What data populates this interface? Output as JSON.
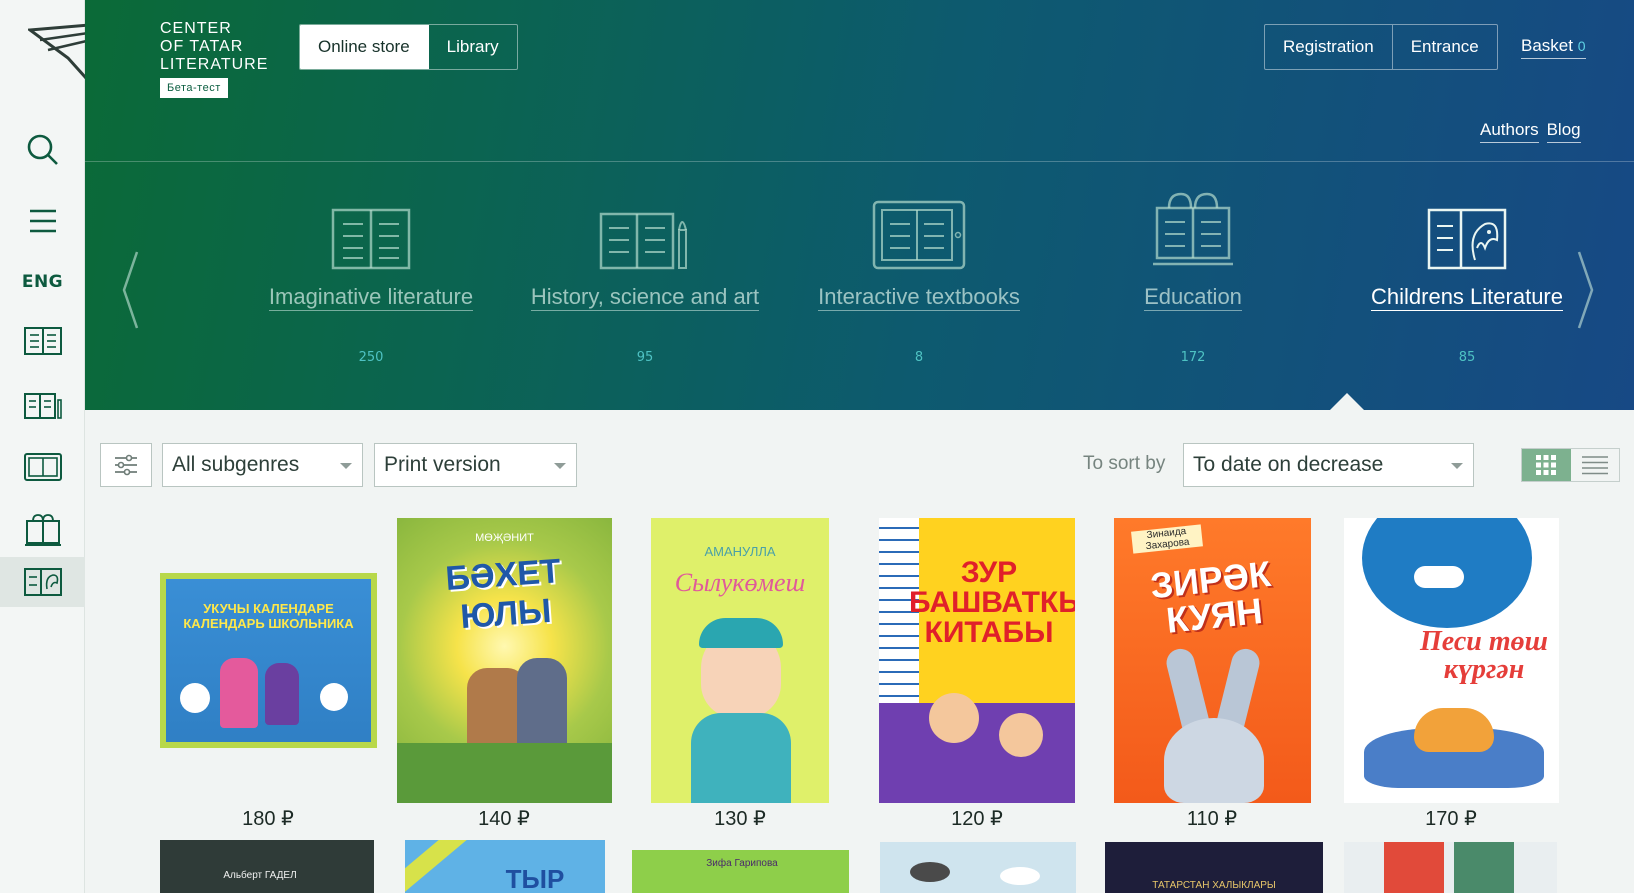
{
  "brand": {
    "line1": "CENTER",
    "line2": "OF TATAR",
    "line3": "LITERATURE",
    "beta": "Бета-тест"
  },
  "sidebar": {
    "lang": "ENG"
  },
  "header": {
    "tabs": [
      {
        "label": "Online store",
        "active": true
      },
      {
        "label": "Library",
        "active": false
      }
    ],
    "auth": [
      {
        "label": "Registration"
      },
      {
        "label": "Entrance"
      }
    ],
    "basket_label": "Basket",
    "basket_count": "0",
    "links": [
      {
        "label": "Authors"
      },
      {
        "label": "Blog"
      }
    ]
  },
  "categories": [
    {
      "label": "Imaginative literature",
      "count": "250",
      "icon": "two-books-icon"
    },
    {
      "label": "History, science and art",
      "count": "95",
      "icon": "books-brush-icon"
    },
    {
      "label": "Interactive textbooks",
      "count": "8",
      "icon": "tablet-book-icon"
    },
    {
      "label": "Education",
      "count": "172",
      "icon": "backpack-book-icon"
    },
    {
      "label": "Childrens Literature",
      "count": "85",
      "icon": "kids-book-icon",
      "active": true
    }
  ],
  "toolbar": {
    "subgenre": "All subgenres",
    "version": "Print version",
    "sort_label": "To sort by",
    "sort_value": "To date on decrease"
  },
  "books": [
    {
      "title": "УКУЧЫ КАЛЕНДАРЕ КАЛЕНДАРЬ ШКОЛЬНИКА",
      "price": "180 ₽"
    },
    {
      "author": "МӨҖӘНИТ",
      "title": "БӘХЕТ ЮЛЫ",
      "price": "140 ₽"
    },
    {
      "author": "АМАНУЛЛА",
      "title": "Сылукөмеш",
      "price": "130 ₽"
    },
    {
      "title": "ЗУР БАШВАТКЫЧЛАР КИТАБЫ",
      "price": "120 ₽"
    },
    {
      "author": "Зинаида Захарова",
      "title": "ЗИРӘК КУЯН",
      "price": "110 ₽"
    },
    {
      "title": "Песи төш күргән",
      "price": "170 ₽"
    }
  ],
  "books_row2": [
    {
      "author": "Альберт ГАДЕЛ"
    },
    {
      "title": "ТЫР"
    },
    {
      "author": "Зифа Гарипова"
    },
    {
      "title": ""
    },
    {
      "title": "ТАТАРСТАН ХАЛЫКЛАРЫ"
    },
    {
      "title": ""
    }
  ],
  "colors": {
    "green": "#0b6a37",
    "blue": "#174985",
    "accent": "#4ec2c3"
  }
}
